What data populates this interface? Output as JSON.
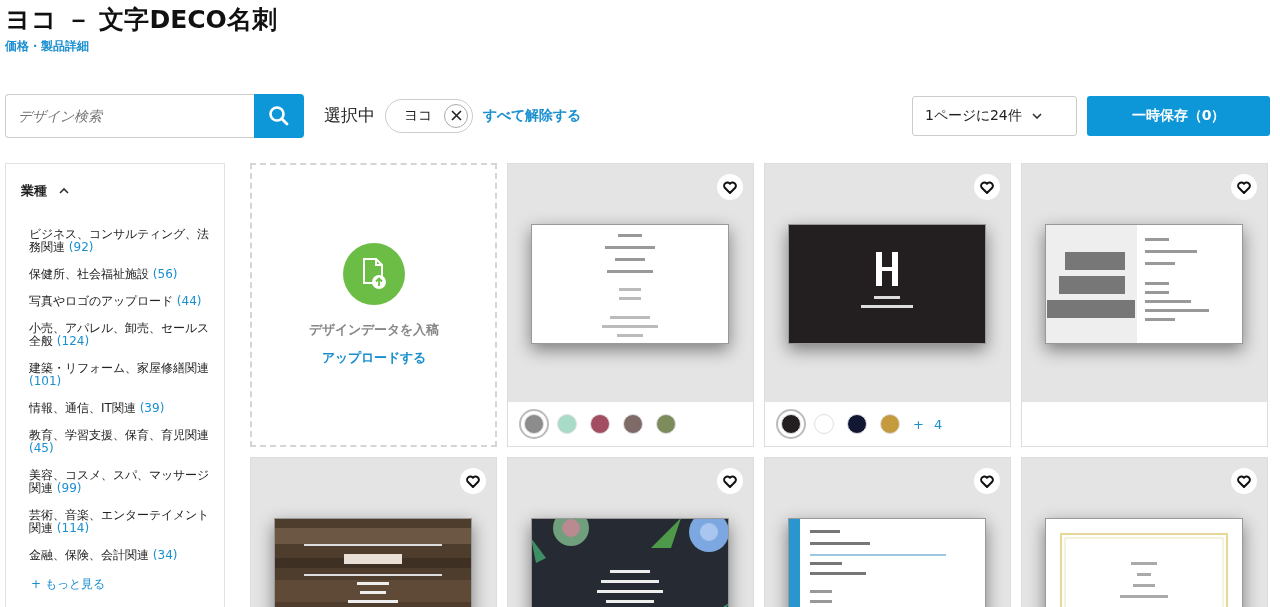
{
  "title": "ヨコ － 文字DECO名刺",
  "price_link": "価格・製品詳細",
  "search": {
    "placeholder": "デザイン検索"
  },
  "selected_label": "選択中",
  "filter_chips": [
    {
      "label": "ヨコ"
    }
  ],
  "clear_all": "すべて解除する",
  "per_page": {
    "value": "1ページに24件"
  },
  "save_button": "一時保存（0）",
  "sidebar": {
    "heading": "業種",
    "expanded": true,
    "items": [
      {
        "label": "ビジネス、コンサルティング、法務関連",
        "count": "(92)"
      },
      {
        "label": "保健所、社会福祉施設",
        "count": "(56)"
      },
      {
        "label": "写真やロゴのアップロード",
        "count": "(44)"
      },
      {
        "label": "小売、アパレル、卸売、セールス全般",
        "count": "(124)"
      },
      {
        "label": "建築・リフォーム、家屋修繕関連",
        "count": "(101)"
      },
      {
        "label": "情報、通信、IT関連",
        "count": "(39)"
      },
      {
        "label": "教育、学習支援、保育、育児関連",
        "count": "(45)"
      },
      {
        "label": "美容、コスメ、スパ、マッサージ関連",
        "count": "(99)"
      },
      {
        "label": "芸術、音楽、エンターテイメント関連",
        "count": "(114)"
      },
      {
        "label": "金融、保険、会計関連",
        "count": "(34)"
      }
    ],
    "more": "+ もっと見る"
  },
  "upload_tile": {
    "text": "デザインデータを入稿",
    "link": "アップロードする"
  },
  "designs": [
    {
      "kind": "picture",
      "swatches": [
        {
          "color": "#8c8c8c",
          "selected": true
        },
        {
          "color": "#a8dcc8",
          "selected": false
        },
        {
          "color": "#a24d62",
          "selected": false
        },
        {
          "color": "#7e6a66",
          "selected": false
        },
        {
          "color": "#7c8c5c",
          "selected": false
        }
      ]
    },
    {
      "kind": "picture",
      "swatches": [
        {
          "color": "#231f20",
          "selected": true
        },
        {
          "color": "#ffffff",
          "selected": false
        },
        {
          "color": "#121833",
          "selected": false
        },
        {
          "color": "#c49a3c",
          "selected": false
        }
      ],
      "more_colors": "+ 4"
    },
    {
      "kind": "picture"
    },
    {
      "kind": "picture"
    },
    {
      "kind": "picture"
    },
    {
      "kind": "picture"
    },
    {
      "kind": "picture"
    }
  ]
}
